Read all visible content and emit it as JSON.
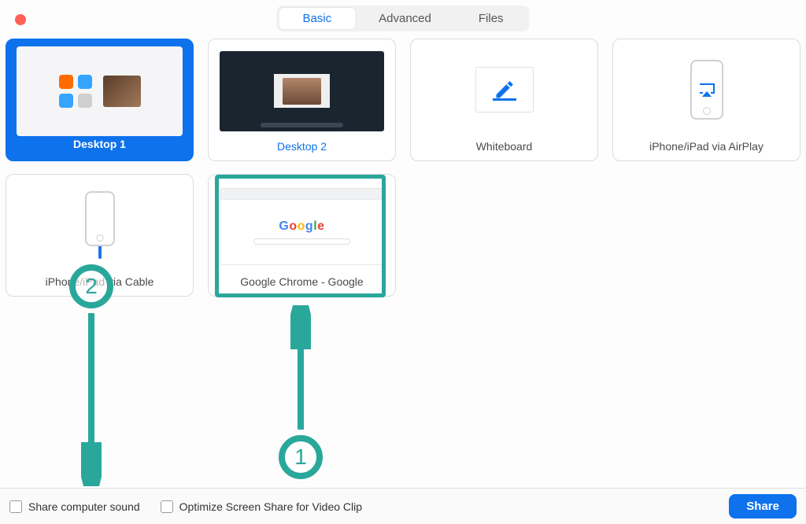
{
  "tabs": {
    "basic": "Basic",
    "advanced": "Advanced",
    "files": "Files",
    "active": "basic"
  },
  "tiles": {
    "desktop1": "Desktop 1",
    "desktop2": "Desktop 2",
    "whiteboard": "Whiteboard",
    "airplay": "iPhone/iPad via AirPlay",
    "cable": "iPhone/iPad via Cable",
    "chrome": "Google Chrome - Google"
  },
  "footer": {
    "share_sound": "Share computer sound",
    "optimize": "Optimize Screen Share for Video Clip",
    "share_btn": "Share"
  },
  "annotations": {
    "step1": "1",
    "step2": "2"
  },
  "colors": {
    "accent": "#0e72ed",
    "annotation": "#2aa79b"
  }
}
